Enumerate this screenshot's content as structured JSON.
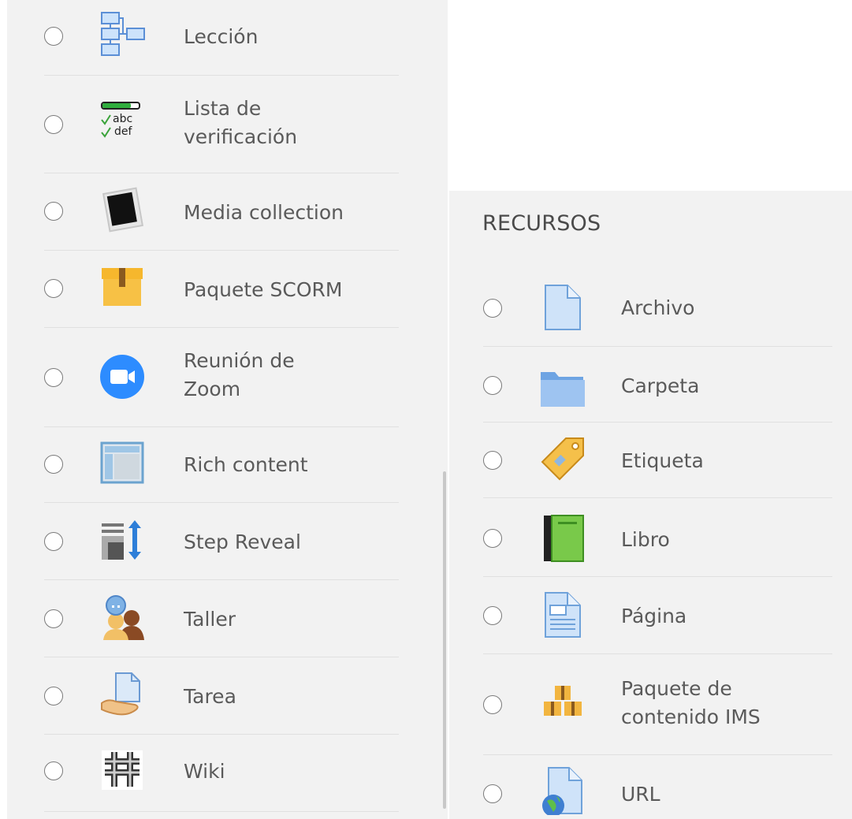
{
  "left_list": {
    "items": [
      {
        "label": "Lección"
      },
      {
        "label": "Lista de verificación"
      },
      {
        "label": "Media collection"
      },
      {
        "label": "Paquete SCORM"
      },
      {
        "label": "Reunión de Zoom"
      },
      {
        "label": "Rich content"
      },
      {
        "label": "Step Reveal"
      },
      {
        "label": "Taller"
      },
      {
        "label": "Tarea"
      },
      {
        "label": "Wiki"
      }
    ]
  },
  "resources": {
    "title": "RECURSOS",
    "items": [
      {
        "label": "Archivo"
      },
      {
        "label": "Carpeta"
      },
      {
        "label": "Etiqueta"
      },
      {
        "label": "Libro"
      },
      {
        "label": "Página"
      },
      {
        "label": "Paquete de contenido IMS"
      },
      {
        "label": "URL"
      }
    ]
  },
  "icons": {
    "Lección": "lesson-flowchart-icon",
    "Lista de verificación": "checklist-icon",
    "Media collection": "media-collection-icon",
    "Paquete SCORM": "scorm-package-icon",
    "Reunión de Zoom": "zoom-meeting-icon",
    "Rich content": "rich-content-icon",
    "Step Reveal": "step-reveal-icon",
    "Taller": "workshop-icon",
    "Tarea": "assignment-icon",
    "Wiki": "wiki-icon",
    "Archivo": "file-icon",
    "Carpeta": "folder-icon",
    "Etiqueta": "label-tag-icon",
    "Libro": "book-icon",
    "Página": "page-icon",
    "Paquete de contenido IMS": "ims-package-icon",
    "URL": "url-icon"
  }
}
